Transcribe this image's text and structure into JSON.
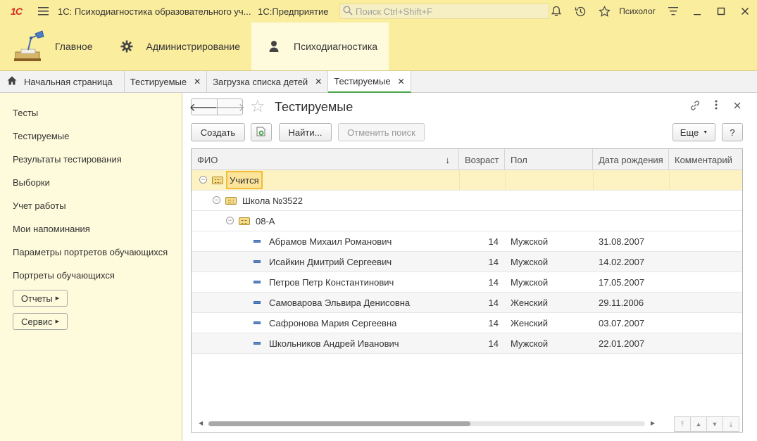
{
  "titlebar": {
    "logo": "1C",
    "app_title": "1С: Психодиагностика образовательного уч...",
    "platform": "1С:Предприятие",
    "search_placeholder": "Поиск Ctrl+Shift+F",
    "user": "Психолог",
    "icons": [
      "menu-icon",
      "search-icon",
      "bell-icon",
      "history-icon",
      "star-icon",
      "settings-icon",
      "minimize-icon",
      "maximize-icon",
      "close-icon"
    ]
  },
  "sections": [
    {
      "label": "Главное",
      "icon": "desk-lamp-icon",
      "active": false
    },
    {
      "label": "Администрирование",
      "icon": "gear-icon",
      "active": false
    },
    {
      "label": "Психодиагностика",
      "icon": "person-icon",
      "active": true
    }
  ],
  "window_tabs": [
    {
      "label": "Начальная страница",
      "closable": false,
      "active": false
    },
    {
      "label": "Тестируемые",
      "closable": true,
      "active": false
    },
    {
      "label": "Загрузка списка детей",
      "closable": true,
      "active": false
    },
    {
      "label": "Тестируемые",
      "closable": true,
      "active": true
    }
  ],
  "left_panel": {
    "items": [
      "Тесты",
      "Тестируемые",
      "Результаты тестирования",
      "Выборки",
      "Учет работы",
      "Мои напоминания",
      "Параметры портретов обучающихся",
      "Портреты обучающихся"
    ],
    "submenus": [
      "Отчеты",
      "Сервис"
    ]
  },
  "form": {
    "title": "Тестируемые",
    "buttons": {
      "create": "Создать",
      "find": "Найти...",
      "cancel_search": "Отменить поиск",
      "more": "Еще",
      "help": "?"
    },
    "columns": [
      "ФИО",
      "Возраст",
      "Пол",
      "Дата рождения",
      "Комментарий"
    ],
    "groups": [
      "Учится",
      "Школа №3522",
      "08-А"
    ],
    "rows": [
      {
        "name": "Абрамов Михаил Романович",
        "age": "14",
        "gender": "Мужской",
        "birth": "31.08.2007",
        "comment": ""
      },
      {
        "name": "Исайкин Дмитрий Сергеевич",
        "age": "14",
        "gender": "Мужской",
        "birth": "14.02.2007",
        "comment": ""
      },
      {
        "name": "Петров Петр Константинович",
        "age": "14",
        "gender": "Мужской",
        "birth": "17.05.2007",
        "comment": ""
      },
      {
        "name": "Самоварова Эльвира Денисовна",
        "age": "14",
        "gender": "Женский",
        "birth": "29.11.2006",
        "comment": ""
      },
      {
        "name": "Сафронова Мария Сергеевна",
        "age": "14",
        "gender": "Женский",
        "birth": "03.07.2007",
        "comment": ""
      },
      {
        "name": "Школьников Андрей Иванович",
        "age": "14",
        "gender": "Мужской",
        "birth": "22.01.2007",
        "comment": ""
      }
    ]
  },
  "colors": {
    "header_yellow": "#fbed9e",
    "panel_yellow": "#fefbdc",
    "active_tab_underline": "#4aa34a",
    "selected_row": "#fdf2c2",
    "logo_red": "#d42a20"
  }
}
